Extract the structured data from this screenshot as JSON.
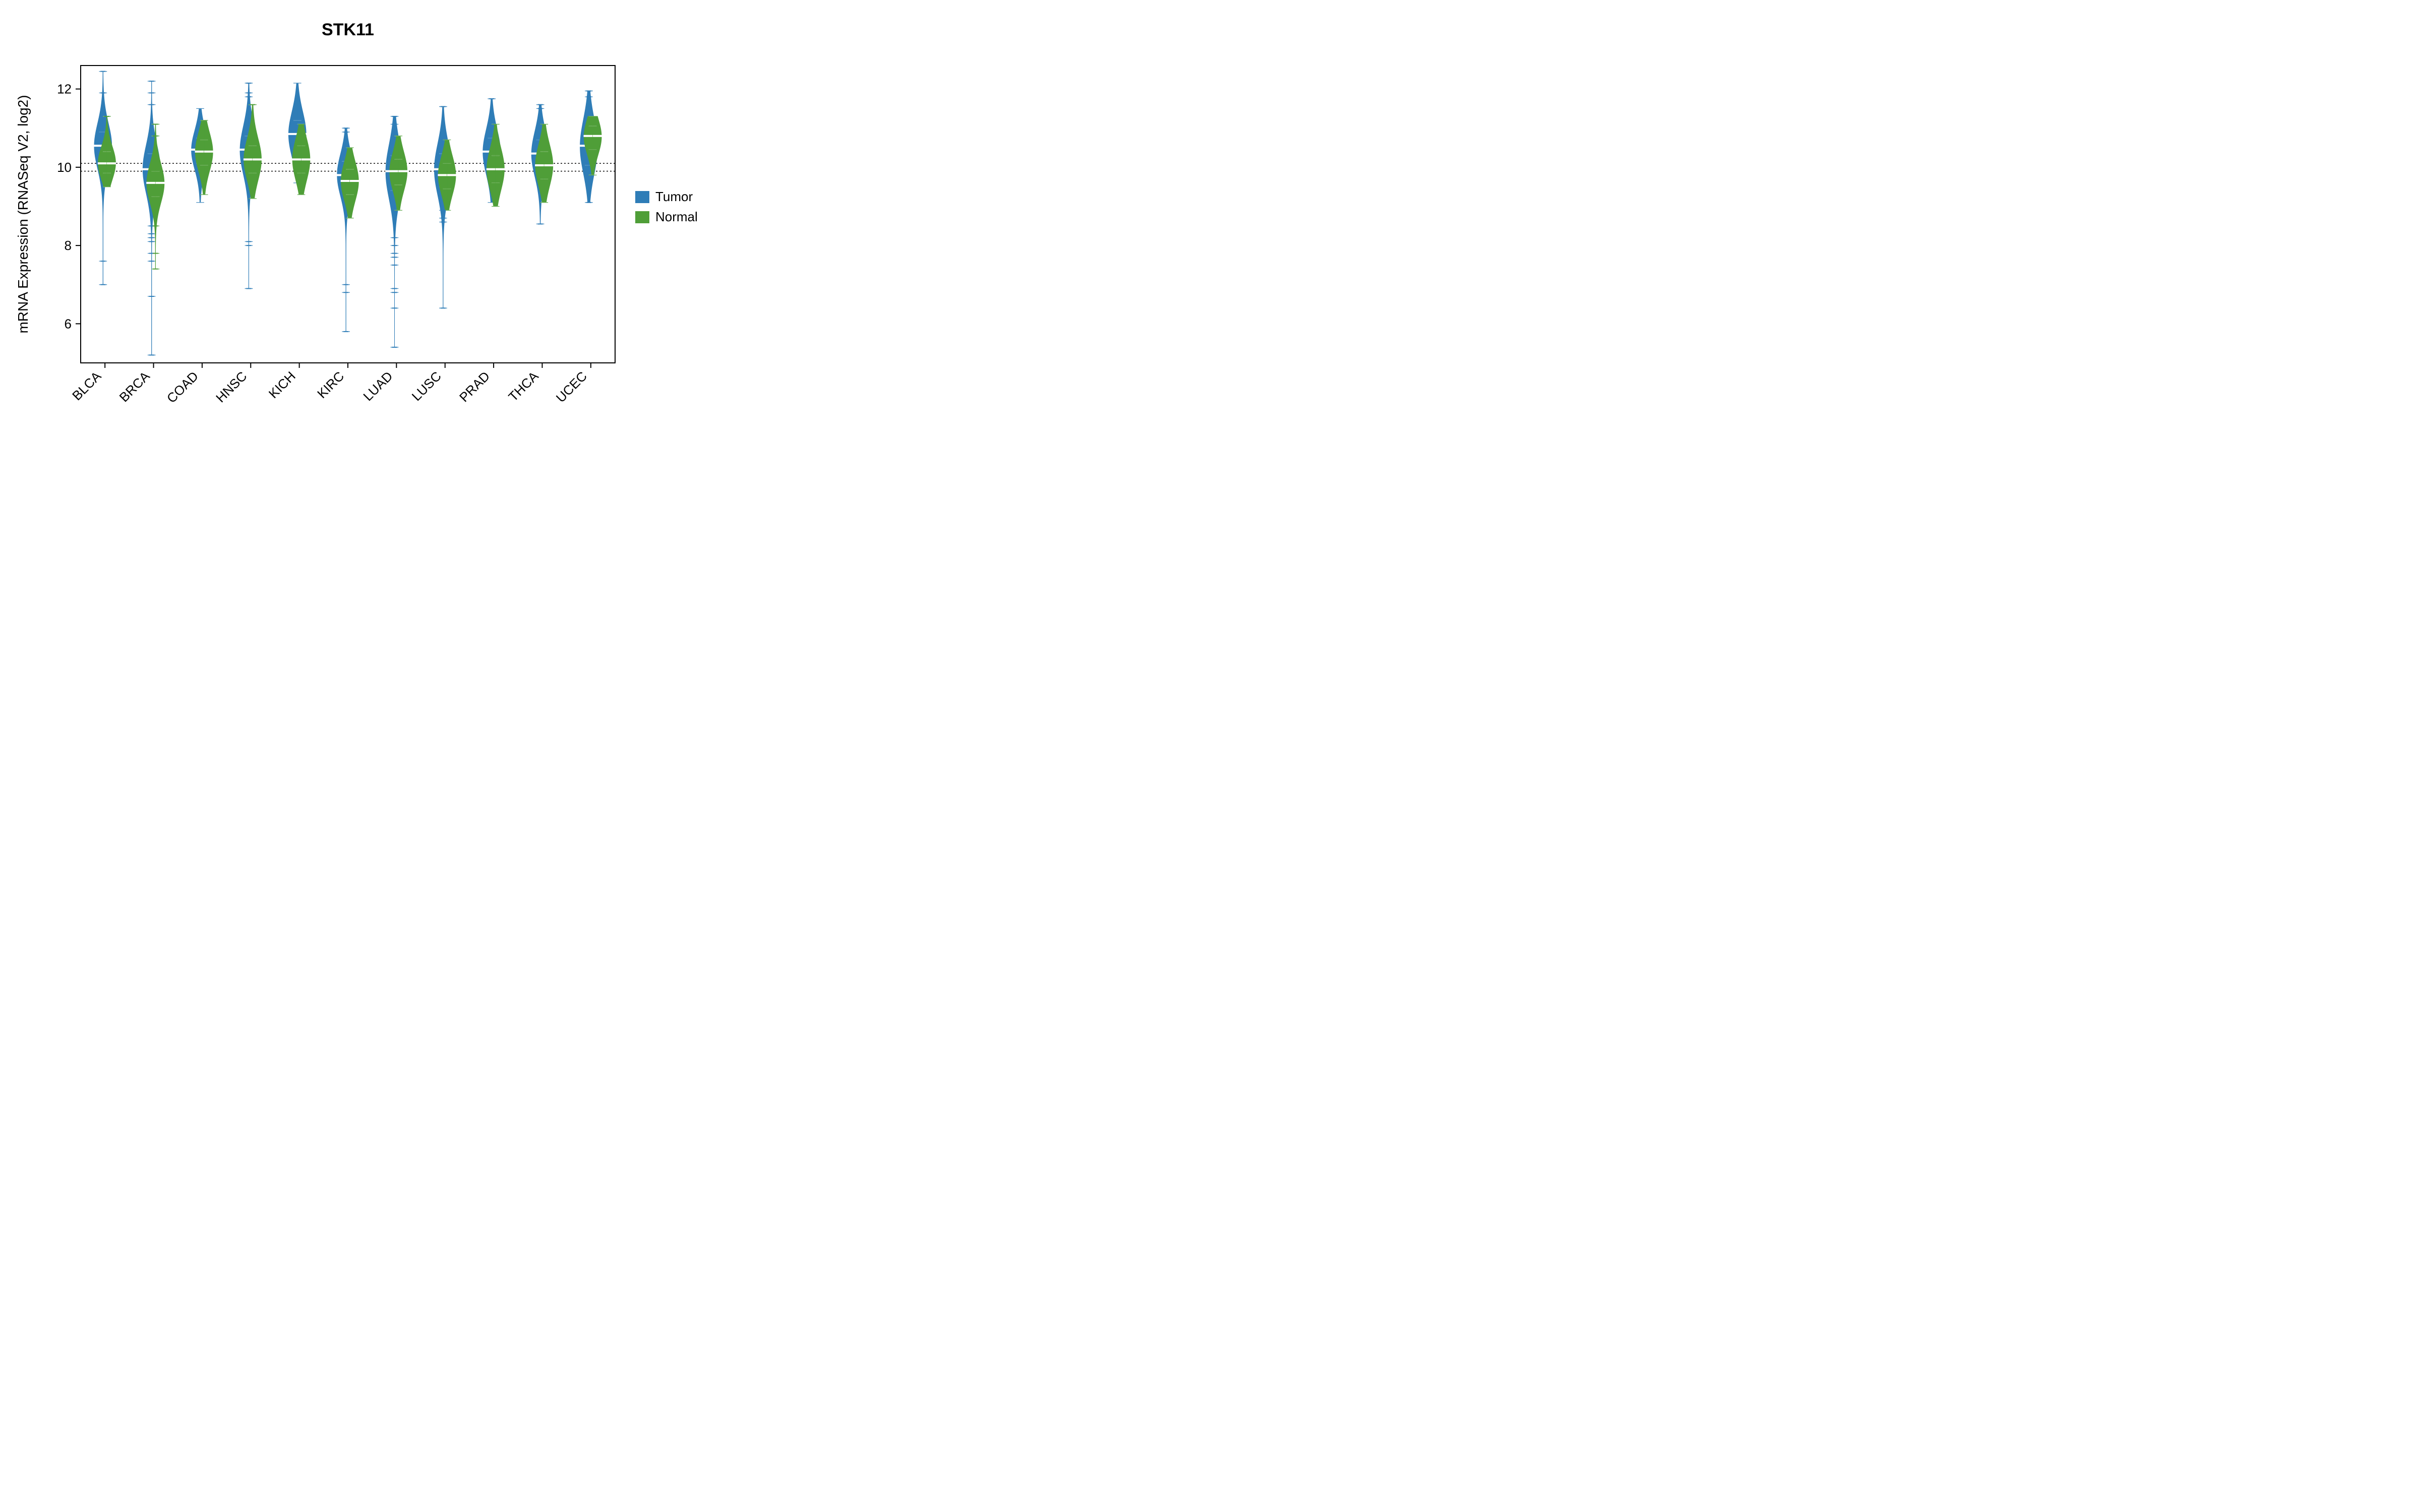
{
  "chart_data": {
    "type": "beanplot",
    "title": "STK11",
    "ylabel": "mRNA Expression (RNASeq V2, log2)",
    "xlabel": "",
    "ylim": [
      5,
      12.6
    ],
    "yticks": [
      6,
      8,
      10,
      12
    ],
    "hlines": [
      9.9,
      10.1
    ],
    "categories": [
      "BLCA",
      "BRCA",
      "COAD",
      "HNSC",
      "KICH",
      "KIRC",
      "LUAD",
      "LUSC",
      "PRAD",
      "THCA",
      "UCEC"
    ],
    "series": [
      {
        "name": "Tumor",
        "color": "#2F7DB7"
      },
      {
        "name": "Normal",
        "color": "#4F9E38"
      }
    ],
    "legend": {
      "position": "right",
      "items": [
        "Tumor",
        "Normal"
      ]
    },
    "data": {
      "BLCA": {
        "Tumor": {
          "median": 10.55,
          "p25": 10.15,
          "p75": 10.9,
          "min": 7.0,
          "max": 12.45,
          "outliers": [
            7.0,
            7.6,
            11.9,
            12.45
          ]
        },
        "Normal": {
          "median": 10.1,
          "p25": 9.85,
          "p75": 10.4,
          "min": 9.5,
          "max": 11.3,
          "outliers": [
            11.3
          ]
        }
      },
      "BRCA": {
        "Tumor": {
          "median": 9.95,
          "p25": 9.55,
          "p75": 10.35,
          "min": 5.2,
          "max": 12.2,
          "outliers": [
            5.2,
            6.7,
            7.6,
            7.8,
            8.1,
            8.2,
            8.3,
            8.5,
            11.6,
            11.9,
            12.2
          ]
        },
        "Normal": {
          "median": 9.6,
          "p25": 9.25,
          "p75": 9.9,
          "min": 7.4,
          "max": 11.1,
          "outliers": [
            7.4,
            7.8,
            8.5,
            10.8,
            11.1
          ]
        }
      },
      "COAD": {
        "Tumor": {
          "median": 10.45,
          "p25": 10.1,
          "p75": 10.75,
          "min": 9.1,
          "max": 11.5,
          "outliers": []
        },
        "Normal": {
          "median": 10.4,
          "p25": 10.05,
          "p75": 10.7,
          "min": 9.3,
          "max": 11.2,
          "outliers": []
        }
      },
      "HNSC": {
        "Tumor": {
          "median": 10.45,
          "p25": 10.0,
          "p75": 10.8,
          "min": 6.9,
          "max": 12.15,
          "outliers": [
            6.9,
            8.0,
            8.1,
            11.8,
            11.9,
            12.15
          ]
        },
        "Normal": {
          "median": 10.2,
          "p25": 9.85,
          "p75": 10.55,
          "min": 9.2,
          "max": 11.6,
          "outliers": [
            11.6
          ]
        }
      },
      "KICH": {
        "Tumor": {
          "median": 10.85,
          "p25": 10.45,
          "p75": 11.2,
          "min": 9.6,
          "max": 12.15,
          "outliers": []
        },
        "Normal": {
          "median": 10.2,
          "p25": 9.85,
          "p75": 10.55,
          "min": 9.3,
          "max": 11.1,
          "outliers": []
        }
      },
      "KIRC": {
        "Tumor": {
          "median": 9.8,
          "p25": 9.45,
          "p75": 10.15,
          "min": 5.8,
          "max": 11.0,
          "outliers": [
            5.8,
            6.8,
            7.0,
            10.9,
            11.0
          ]
        },
        "Normal": {
          "median": 9.65,
          "p25": 9.3,
          "p75": 9.95,
          "min": 8.7,
          "max": 10.5,
          "outliers": []
        }
      },
      "LUAD": {
        "Tumor": {
          "median": 9.9,
          "p25": 9.4,
          "p75": 10.3,
          "min": 5.4,
          "max": 11.3,
          "outliers": [
            5.4,
            6.4,
            6.8,
            6.9,
            7.5,
            7.7,
            7.8,
            8.0,
            8.2,
            11.1,
            11.3
          ]
        },
        "Normal": {
          "median": 9.9,
          "p25": 9.55,
          "p75": 10.2,
          "min": 8.9,
          "max": 10.8,
          "outliers": []
        }
      },
      "LUSC": {
        "Tumor": {
          "median": 9.95,
          "p25": 9.5,
          "p75": 10.35,
          "min": 6.4,
          "max": 11.55,
          "outliers": [
            6.4,
            8.6,
            8.7,
            8.9,
            11.55
          ]
        },
        "Normal": {
          "median": 9.8,
          "p25": 9.45,
          "p75": 10.1,
          "min": 8.9,
          "max": 10.7,
          "outliers": []
        }
      },
      "PRAD": {
        "Tumor": {
          "median": 10.4,
          "p25": 10.0,
          "p75": 10.75,
          "min": 9.1,
          "max": 11.75,
          "outliers": [
            11.75
          ]
        },
        "Normal": {
          "median": 9.95,
          "p25": 9.6,
          "p75": 10.3,
          "min": 9.0,
          "max": 11.1,
          "outliers": []
        }
      },
      "THCA": {
        "Tumor": {
          "median": 10.35,
          "p25": 9.95,
          "p75": 10.7,
          "min": 8.55,
          "max": 11.6,
          "outliers": [
            8.55,
            11.5,
            11.6
          ]
        },
        "Normal": {
          "median": 10.05,
          "p25": 9.7,
          "p75": 10.4,
          "min": 9.1,
          "max": 11.1,
          "outliers": []
        }
      },
      "UCEC": {
        "Tumor": {
          "median": 10.55,
          "p25": 10.05,
          "p75": 10.95,
          "min": 9.1,
          "max": 11.95,
          "outliers": [
            9.1,
            11.8,
            11.95
          ]
        },
        "Normal": {
          "median": 10.8,
          "p25": 10.45,
          "p75": 11.05,
          "min": 9.8,
          "max": 11.3,
          "outliers": []
        }
      }
    }
  }
}
